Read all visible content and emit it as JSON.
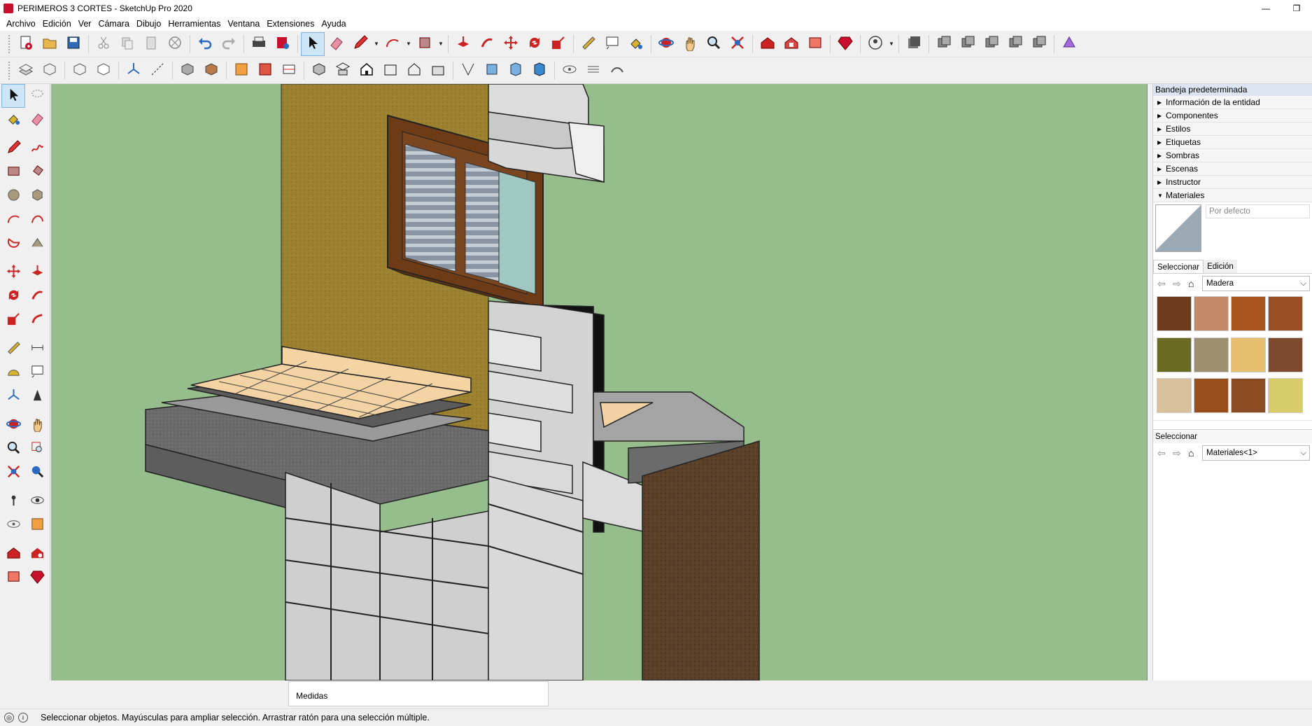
{
  "window": {
    "title": "PERIMEROS 3 CORTES - SketchUp Pro 2020",
    "minimize": "—",
    "maximize": "❐"
  },
  "menu": [
    "Archivo",
    "Edición",
    "Ver",
    "Cámara",
    "Dibujo",
    "Herramientas",
    "Ventana",
    "Extensiones",
    "Ayuda"
  ],
  "toolbar_top": [
    "new-icon",
    "open-icon",
    "save-icon",
    "|",
    "cut-icon",
    "copy-icon",
    "paste-icon",
    "erase-icon",
    "|",
    "undo-icon",
    "redo-icon",
    "|",
    "print-icon",
    "model-info-icon",
    "|",
    "select-icon",
    "eraser-icon",
    "pencil-icon",
    "v",
    "arc-icon",
    "v",
    "shape-icon",
    "v",
    "|",
    "push-pull-icon",
    "follow-me-icon",
    "move-icon",
    "rotate-icon",
    "scale-icon",
    "|",
    "tape-icon",
    "text-icon",
    "paint-icon",
    "|",
    "orbit-icon",
    "pan-icon",
    "zoom-icon",
    "zoom-extents-icon",
    "|",
    "warehouse-icon",
    "extension-warehouse-icon",
    "layout-icon",
    "|",
    "ruby-icon",
    "|",
    "account-icon",
    "v",
    "|",
    "outliner-icon",
    "|",
    "solid-union-icon",
    "solid-subtract-icon",
    "solid-trim-icon",
    "solid-split-icon",
    "solid-outer-icon",
    "|",
    "prism-icon"
  ],
  "toolbar_second": [
    "xray-icon",
    "back-edges-icon",
    "|",
    "wireframe-icon",
    "hidden-line-icon",
    "|",
    "axes-icon",
    "guides-icon",
    "|",
    "shaded-icon",
    "textured-icon",
    "|",
    "section-plane-icon",
    "section-fill-icon",
    "section-cut-icon",
    "|",
    "iso-icon",
    "top-icon",
    "front-icon",
    "right-icon",
    "back-icon",
    "left-icon",
    "|",
    "perspective-icon",
    "parallel-icon",
    "two-point-icon",
    "section-display-icon",
    "|",
    "walk-icon",
    "look-icon",
    "position-icon"
  ],
  "left_toolbar": [
    [
      "select-icon",
      "lasso-icon"
    ],
    [
      "paint-icon",
      "eraser-icon"
    ],
    "gap",
    [
      "pencil-icon",
      "freehand-icon"
    ],
    [
      "rectangle-icon",
      "rotated-rectangle-icon"
    ],
    [
      "circle-icon",
      "polygon-icon"
    ],
    [
      "arc-icon",
      "two-point-arc-icon"
    ],
    [
      "pie-icon",
      "three-point-arc-icon"
    ],
    "gap",
    [
      "move-icon",
      "push-pull-icon"
    ],
    [
      "rotate-icon",
      "follow-me-icon"
    ],
    [
      "scale-icon",
      "offset-icon"
    ],
    "gap",
    [
      "tape-icon",
      "dimension-icon"
    ],
    [
      "protractor-icon",
      "text-icon"
    ],
    [
      "axes-icon",
      "3d-text-icon"
    ],
    "gap",
    [
      "orbit-icon",
      "pan-icon"
    ],
    [
      "zoom-icon",
      "zoom-window-icon"
    ],
    [
      "zoom-extents-icon",
      "previous-icon"
    ],
    "gap",
    [
      "position-camera-icon",
      "look-around-icon"
    ],
    [
      "walk-icon",
      "section-plane-icon"
    ],
    "gap",
    [
      "warehouse-icon",
      "extension-icon"
    ],
    [
      "layout-icon",
      "ruby-icon"
    ]
  ],
  "tray": {
    "title": "Bandeja predeterminada",
    "panels": [
      {
        "label": "Información de la entidad",
        "open": false
      },
      {
        "label": "Componentes",
        "open": false
      },
      {
        "label": "Estilos",
        "open": false
      },
      {
        "label": "Etiquetas",
        "open": false
      },
      {
        "label": "Sombras",
        "open": false
      },
      {
        "label": "Escenas",
        "open": false
      },
      {
        "label": "Instructor",
        "open": false
      },
      {
        "label": "Materiales",
        "open": true
      }
    ],
    "material_name_placeholder": "Por defecto",
    "tab_select": "Seleccionar",
    "tab_edit": "Edición",
    "library": "Madera",
    "swatches": [
      "#6e3a1c",
      "#c48a68",
      "#a9561e",
      "#9c4e24",
      "#6a6a22",
      "#9c9070",
      "#e7bd6e",
      "#7d4a2e",
      "#d8c09a",
      "#9a4e1c",
      "#8a4a22",
      "#d8cc6a"
    ],
    "secondary_label": "Seleccionar",
    "secondary_library": "Materiales<1>"
  },
  "measurements_label": "Medidas",
  "status": "Seleccionar objetos. Mayúsculas para ampliar selección. Arrastrar ratón para una selección múltiple."
}
